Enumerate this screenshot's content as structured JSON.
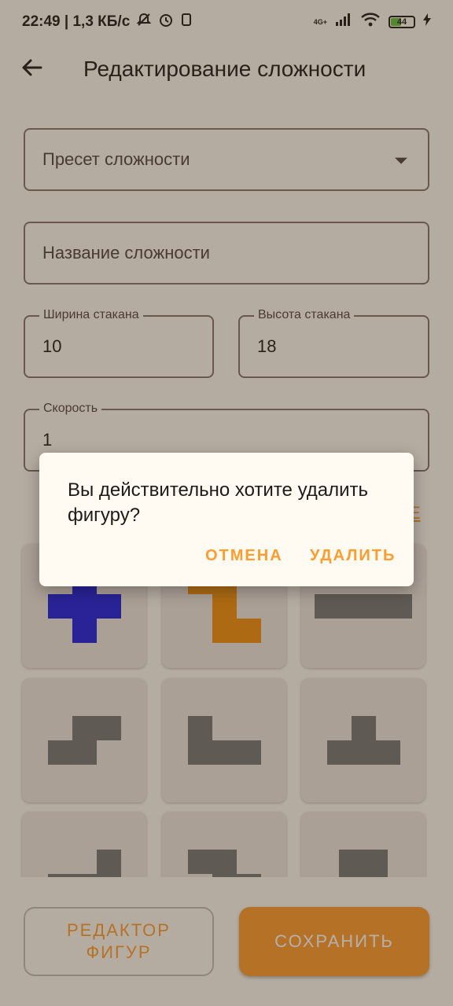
{
  "status_bar": {
    "time_speed": "22:49 | 1,3 КБ/с",
    "network_label": "4G+",
    "battery": "44"
  },
  "header": {
    "title": "Редактирование сложности"
  },
  "form": {
    "preset": {
      "placeholder": "Пресет сложности"
    },
    "name": {
      "placeholder": "Название сложности"
    },
    "width": {
      "label": "Ширина стакана",
      "value": "10"
    },
    "height": {
      "label": "Высота стакана",
      "value": "18"
    },
    "speed": {
      "label": "Скорость",
      "value": "1"
    },
    "partial_label": "Е"
  },
  "figures": [
    {
      "color": "#1e1ee3",
      "cells": [
        [
          1,
          0
        ],
        [
          0,
          1
        ],
        [
          1,
          1
        ],
        [
          2,
          1
        ],
        [
          1,
          2
        ]
      ]
    },
    {
      "color": "#f2900d",
      "cells": [
        [
          0,
          0
        ],
        [
          1,
          0
        ],
        [
          1,
          1
        ],
        [
          1,
          2
        ],
        [
          2,
          2
        ]
      ]
    },
    {
      "color": "#777777",
      "cells": [
        [
          0,
          0
        ],
        [
          1,
          0
        ],
        [
          2,
          0
        ],
        [
          3,
          0
        ]
      ]
    },
    {
      "color": "#777777",
      "cells": [
        [
          1,
          0
        ],
        [
          2,
          0
        ],
        [
          0,
          1
        ],
        [
          1,
          1
        ]
      ]
    },
    {
      "color": "#777777",
      "cells": [
        [
          0,
          0
        ],
        [
          0,
          1
        ],
        [
          1,
          1
        ],
        [
          2,
          1
        ]
      ]
    },
    {
      "color": "#777777",
      "cells": [
        [
          1,
          0
        ],
        [
          0,
          1
        ],
        [
          1,
          1
        ],
        [
          2,
          1
        ]
      ]
    },
    {
      "color": "#777777",
      "cells": [
        [
          2,
          0
        ],
        [
          0,
          1
        ],
        [
          1,
          1
        ],
        [
          2,
          1
        ]
      ]
    },
    {
      "color": "#777777",
      "cells": [
        [
          0,
          0
        ],
        [
          1,
          0
        ],
        [
          1,
          1
        ],
        [
          2,
          1
        ]
      ]
    },
    {
      "color": "#777777",
      "cells": [
        [
          0,
          0
        ],
        [
          1,
          0
        ],
        [
          0,
          1
        ],
        [
          1,
          1
        ]
      ]
    }
  ],
  "buttons": {
    "figure_editor": "РЕДАКТОР ФИГУР",
    "save": "СОХРАНИТЬ"
  },
  "dialog": {
    "message": "Вы действительно хотите удалить фигуру?",
    "cancel": "ОТМЕНА",
    "delete": "УДАЛИТЬ"
  },
  "colors": {
    "accent": "#ff9d2e"
  }
}
